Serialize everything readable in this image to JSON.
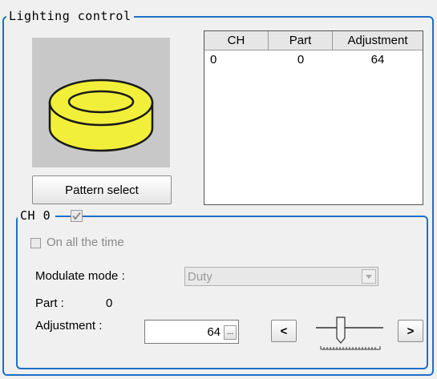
{
  "lighting_group": {
    "title": "Lighting control"
  },
  "pattern_button": {
    "label": "Pattern select"
  },
  "table": {
    "headers": [
      "CH",
      "Part",
      "Adjustment"
    ],
    "rows": [
      [
        "0",
        "0",
        "64"
      ]
    ]
  },
  "channel_group": {
    "title": "CH 0",
    "enabled_checked": true
  },
  "on_all_time": {
    "label": "On all the time",
    "checked": false
  },
  "modulate": {
    "label": "Modulate mode :",
    "value": "Duty"
  },
  "part": {
    "label": "Part :",
    "value": "0"
  },
  "adjustment": {
    "label": "Adjustment :",
    "value": "64",
    "ellipsis_label": "...",
    "decrease_label": "<",
    "increase_label": ">"
  },
  "colors": {
    "group_border": "#1e6fc8",
    "ring": "#f2ef3a"
  },
  "icons": [
    "checkmark-icon",
    "dropdown-arrow-icon",
    "slider-thumb-icon"
  ]
}
